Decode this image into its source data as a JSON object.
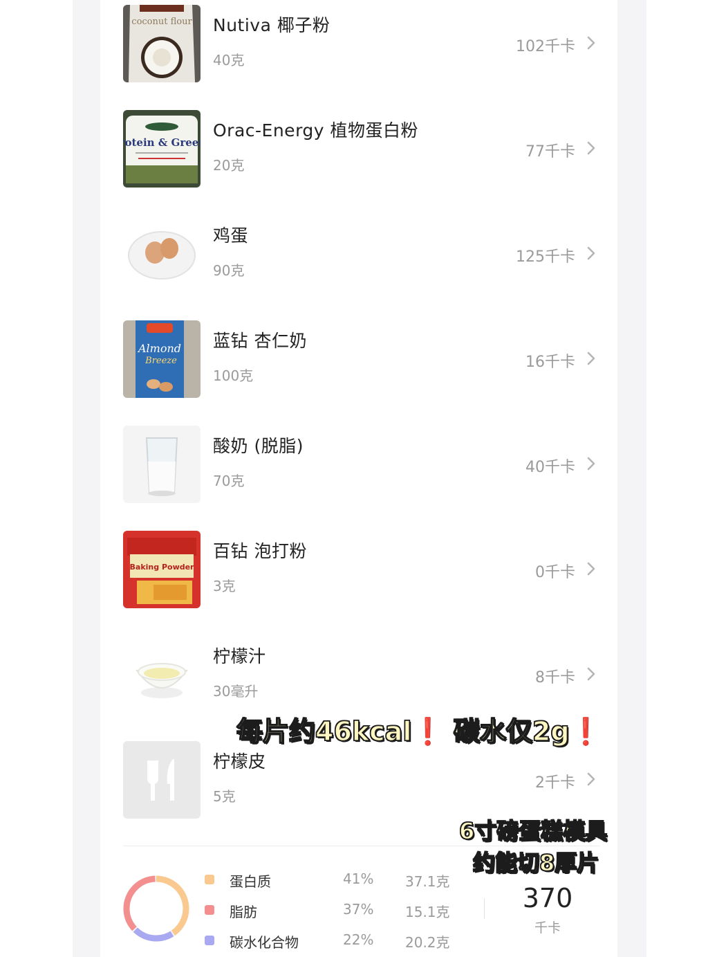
{
  "foods": [
    {
      "name": "Nutiva 椰子粉",
      "amount": "40克",
      "kcal": "102千卡",
      "thumbnail": "coconut-flour-bag-photo"
    },
    {
      "name": "Orac-Energy 植物蛋白粉",
      "amount": "20克",
      "kcal": "77千卡",
      "thumbnail": "protein-greens-jar-photo"
    },
    {
      "name": "鸡蛋",
      "amount": "90克",
      "kcal": "125千卡",
      "thumbnail": "eggs-on-plate-photo"
    },
    {
      "name": "蓝钻 杏仁奶",
      "amount": "100克",
      "kcal": "16千卡",
      "thumbnail": "almond-breeze-carton-photo"
    },
    {
      "name": "酸奶 (脱脂)",
      "amount": "70克",
      "kcal": "40千卡",
      "thumbnail": "glass-of-yogurt-photo"
    },
    {
      "name": "百钻 泡打粉",
      "amount": "3克",
      "kcal": "0千卡",
      "thumbnail": "baking-powder-pack-photo"
    },
    {
      "name": "柠檬汁",
      "amount": "30毫升",
      "kcal": "8千卡",
      "thumbnail": "bowl-of-lemon-juice-photo"
    },
    {
      "name": "柠檬皮",
      "amount": "5克",
      "kcal": "2千卡",
      "thumbnail": "fork-knife-placeholder-icon"
    }
  ],
  "overlay": {
    "line1_a": "每片约46kcal",
    "line1_b": "碳水仅2g",
    "bang": "❗",
    "corner_line1": "6寸磅蛋糕模具",
    "corner_line2": "约能切8厚片"
  },
  "summary": {
    "macros": [
      {
        "name": "蛋白质",
        "percent": "41%",
        "grams": "37.1克",
        "color": "#f9c98f"
      },
      {
        "name": "脂肪",
        "percent": "37%",
        "grams": "15.1克",
        "color": "#f48f8f"
      },
      {
        "name": "碳水化合物",
        "percent": "22%",
        "grams": "20.2克",
        "color": "#a8a9f0"
      }
    ],
    "total_kcal": "370",
    "total_unit": "千卡"
  },
  "colors": {
    "accent_protein": "#f9c98f",
    "accent_fat": "#f48f8f",
    "accent_carb": "#a8a9f0"
  }
}
